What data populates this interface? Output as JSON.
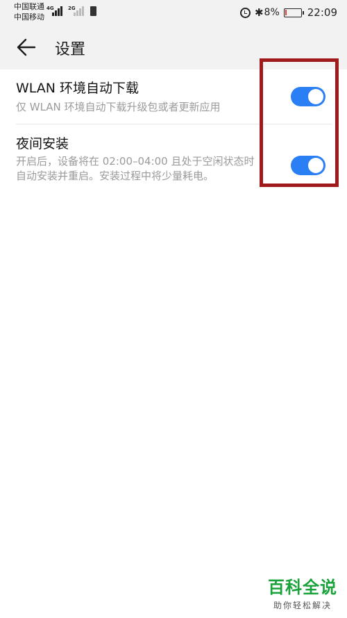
{
  "status_bar": {
    "carrier_1": "中国联通",
    "carrier_2": "中国移动",
    "net_1": "4G",
    "net_2": "2G",
    "battery_percent": "8%",
    "battery_level": 0.08,
    "time": "22:09",
    "icons": [
      "signal-icon",
      "sim-icon",
      "alarm-icon",
      "bluetooth-icon",
      "battery-icon"
    ]
  },
  "header": {
    "title": "设置",
    "back_icon": "arrow-left-icon"
  },
  "settings": [
    {
      "title": "WLAN 环境自动下载",
      "description": "仅 WLAN 环境自动下载升级包或者更新应用",
      "enabled": true
    },
    {
      "title": "夜间安装",
      "description": "开启后，设备将在 02:00–04:00 且处于空闲状态时自动安装并重启。安装过程中将少量耗电。",
      "enabled": true
    }
  ],
  "colors": {
    "toggle_on": "#2a7ff5",
    "highlight": "#a0191b",
    "watermark": "#1aa23a",
    "battery_low": "#e53935"
  },
  "watermark": {
    "main": "百科全说",
    "sub": "助你轻松解决"
  }
}
